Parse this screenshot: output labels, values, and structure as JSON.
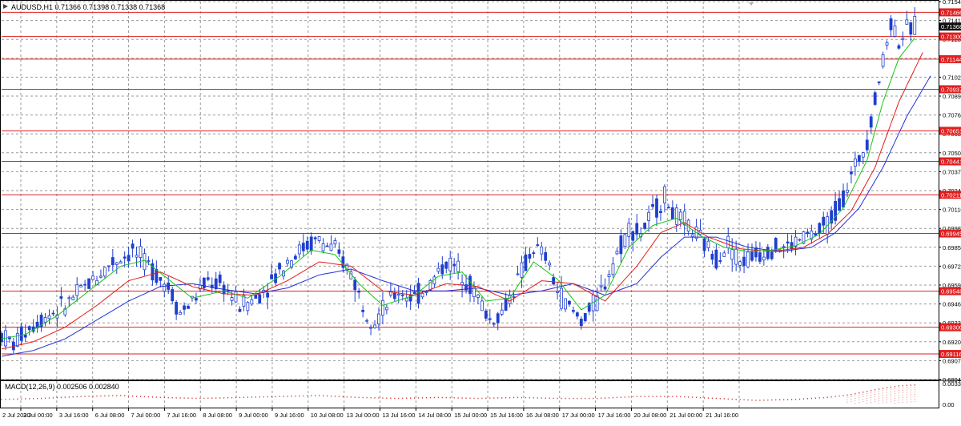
{
  "header": {
    "title": "AUDUSD,H1  0.71366 0.71398 0.71338 0.71368",
    "macd_label": "MACD(12,26,9)  0.002506 0.002840"
  },
  "price_scale": {
    "min": 0.6894,
    "max": 0.7154,
    "ticks": [
      "0.71540",
      "0.71410",
      "0.71280",
      "0.71150",
      "0.71020",
      "0.70890",
      "0.70760",
      "0.70630",
      "0.70500",
      "0.70370",
      "0.70240",
      "0.70110",
      "0.69980",
      "0.69850",
      "0.69720",
      "0.69590",
      "0.69460",
      "0.69330",
      "0.69200",
      "0.69070",
      "0.68940"
    ],
    "tick_values": [
      0.7154,
      0.7141,
      0.7128,
      0.7115,
      0.7102,
      0.7089,
      0.7076,
      0.7063,
      0.705,
      0.7037,
      0.7024,
      0.7011,
      0.6998,
      0.6985,
      0.6972,
      0.6959,
      0.6946,
      0.6933,
      0.692,
      0.6907,
      0.6894
    ],
    "current_price": "0.71368",
    "current_price_value": 0.71368
  },
  "horizontal_levels": [
    {
      "label": "0.71466",
      "value": 0.71466
    },
    {
      "label": "0.71300",
      "value": 0.713
    },
    {
      "label": "0.71144",
      "value": 0.71144
    },
    {
      "label": "0.70937",
      "value": 0.70937
    },
    {
      "label": "0.70651",
      "value": 0.70651
    },
    {
      "label": "0.70441",
      "value": 0.70441
    },
    {
      "label": "0.70211",
      "value": 0.70211
    },
    {
      "label": "0.69945",
      "value": 0.69945
    },
    {
      "label": "0.69548",
      "value": 0.69548
    },
    {
      "label": "0.69300",
      "value": 0.693
    },
    {
      "label": "0.69116",
      "value": 0.69116
    }
  ],
  "macd_scale": {
    "ticks": [
      "0.00335",
      "0.00"
    ]
  },
  "time_axis": [
    "2 Jul 2020",
    "3 Jul 00:00",
    "3 Jul 16:00",
    "6 Jul 08:00",
    "7 Jul 00:00",
    "7 Jul 16:00",
    "8 Jul 08:00",
    "9 Jul 00:00",
    "9 Jul 16:00",
    "10 Jul 08:00",
    "13 Jul 00:00",
    "13 Jul 16:00",
    "14 Jul 08:00",
    "15 Jul 00:00",
    "15 Jul 16:00",
    "16 Jul 08:00",
    "17 Jul 00:00",
    "17 Jul 16:00",
    "20 Jul 08:00",
    "21 Jul 00:00",
    "21 Jul 16:00"
  ],
  "colors": {
    "background": "#ffffff",
    "grid": "#9a9a9a",
    "candles": "#1f3fcf",
    "ma_fast": "#19c319",
    "ma_mid": "#e21d1d",
    "ma_slow": "#2333d6",
    "level_line": "#e02020",
    "level_label_bg": "#e02020",
    "current_label_bg": "#111111",
    "macd": "#d23a3a"
  },
  "chart_data": {
    "type": "candlestick",
    "symbol": "AUDUSD",
    "timeframe": "H1",
    "ylim": [
      0.6894,
      0.7154
    ],
    "price_path": [
      [
        0,
        0.6925
      ],
      [
        3,
        0.6918
      ],
      [
        6,
        0.6928
      ],
      [
        10,
        0.6936
      ],
      [
        16,
        0.6945
      ],
      [
        22,
        0.696
      ],
      [
        28,
        0.6975
      ],
      [
        33,
        0.6982
      ],
      [
        38,
        0.697
      ],
      [
        42,
        0.6958
      ],
      [
        45,
        0.694
      ],
      [
        48,
        0.6948
      ],
      [
        52,
        0.6962
      ],
      [
        56,
        0.6958
      ],
      [
        60,
        0.6945
      ],
      [
        64,
        0.695
      ],
      [
        68,
        0.6962
      ],
      [
        72,
        0.6976
      ],
      [
        76,
        0.6985
      ],
      [
        80,
        0.699
      ],
      [
        84,
        0.6982
      ],
      [
        88,
        0.6968
      ],
      [
        91,
        0.6945
      ],
      [
        94,
        0.6935
      ],
      [
        97,
        0.6945
      ],
      [
        100,
        0.6955
      ],
      [
        104,
        0.695
      ],
      [
        108,
        0.696
      ],
      [
        112,
        0.6975
      ],
      [
        116,
        0.6968
      ],
      [
        120,
        0.695
      ],
      [
        123,
        0.6935
      ],
      [
        126,
        0.694
      ],
      [
        130,
        0.6962
      ],
      [
        134,
        0.6985
      ],
      [
        137,
        0.6978
      ],
      [
        140,
        0.6955
      ],
      [
        143,
        0.6943
      ],
      [
        146,
        0.6935
      ],
      [
        150,
        0.6948
      ],
      [
        154,
        0.6975
      ],
      [
        158,
        0.6998
      ],
      [
        161,
        0.6995
      ],
      [
        164,
        0.7008
      ],
      [
        167,
        0.702
      ],
      [
        170,
        0.7005
      ],
      [
        173,
        0.7
      ],
      [
        176,
        0.699
      ],
      [
        180,
        0.6978
      ],
      [
        183,
        0.6988
      ],
      [
        186,
        0.6975
      ],
      [
        190,
        0.698
      ],
      [
        194,
        0.6985
      ],
      [
        198,
        0.6985
      ],
      [
        202,
        0.6992
      ],
      [
        206,
        0.6995
      ],
      [
        209,
        0.7005
      ],
      [
        212,
        0.702
      ],
      [
        215,
        0.704
      ],
      [
        218,
        0.706
      ],
      [
        221,
        0.71
      ],
      [
        224,
        0.714
      ],
      [
        226,
        0.7128
      ],
      [
        228,
        0.7134
      ],
      [
        230,
        0.7137
      ]
    ],
    "ma_fast_path": [
      [
        0,
        0.6922
      ],
      [
        6,
        0.6925
      ],
      [
        14,
        0.6938
      ],
      [
        22,
        0.6955
      ],
      [
        30,
        0.6972
      ],
      [
        36,
        0.6976
      ],
      [
        42,
        0.6963
      ],
      [
        48,
        0.695
      ],
      [
        56,
        0.6955
      ],
      [
        62,
        0.695
      ],
      [
        70,
        0.6965
      ],
      [
        78,
        0.6983
      ],
      [
        84,
        0.698
      ],
      [
        90,
        0.696
      ],
      [
        96,
        0.6945
      ],
      [
        104,
        0.6952
      ],
      [
        110,
        0.6965
      ],
      [
        116,
        0.6968
      ],
      [
        122,
        0.6948
      ],
      [
        128,
        0.695
      ],
      [
        134,
        0.6975
      ],
      [
        140,
        0.6963
      ],
      [
        146,
        0.6942
      ],
      [
        152,
        0.6952
      ],
      [
        158,
        0.6985
      ],
      [
        164,
        0.7
      ],
      [
        170,
        0.7005
      ],
      [
        176,
        0.6993
      ],
      [
        182,
        0.6985
      ],
      [
        188,
        0.6982
      ],
      [
        194,
        0.6983
      ],
      [
        200,
        0.6986
      ],
      [
        206,
        0.6994
      ],
      [
        212,
        0.7012
      ],
      [
        218,
        0.7045
      ],
      [
        222,
        0.7085
      ],
      [
        226,
        0.7115
      ],
      [
        230,
        0.7129
      ]
    ],
    "ma_mid_path": [
      [
        0,
        0.6915
      ],
      [
        8,
        0.692
      ],
      [
        16,
        0.693
      ],
      [
        24,
        0.6945
      ],
      [
        32,
        0.6962
      ],
      [
        40,
        0.6968
      ],
      [
        48,
        0.6958
      ],
      [
        56,
        0.6953
      ],
      [
        64,
        0.6952
      ],
      [
        72,
        0.6962
      ],
      [
        80,
        0.6975
      ],
      [
        88,
        0.6972
      ],
      [
        96,
        0.6955
      ],
      [
        104,
        0.6952
      ],
      [
        112,
        0.696
      ],
      [
        120,
        0.6958
      ],
      [
        128,
        0.6948
      ],
      [
        136,
        0.6962
      ],
      [
        144,
        0.696
      ],
      [
        152,
        0.6948
      ],
      [
        160,
        0.6972
      ],
      [
        166,
        0.6995
      ],
      [
        172,
        0.7002
      ],
      [
        178,
        0.6992
      ],
      [
        186,
        0.6984
      ],
      [
        194,
        0.6982
      ],
      [
        202,
        0.6985
      ],
      [
        208,
        0.6994
      ],
      [
        214,
        0.701
      ],
      [
        220,
        0.704
      ],
      [
        226,
        0.7085
      ],
      [
        232,
        0.7119
      ]
    ],
    "ma_slow_path": [
      [
        0,
        0.691
      ],
      [
        8,
        0.6914
      ],
      [
        16,
        0.6922
      ],
      [
        24,
        0.6935
      ],
      [
        32,
        0.6948
      ],
      [
        40,
        0.6958
      ],
      [
        48,
        0.696
      ],
      [
        56,
        0.6956
      ],
      [
        64,
        0.6953
      ],
      [
        72,
        0.6957
      ],
      [
        80,
        0.6966
      ],
      [
        88,
        0.697
      ],
      [
        96,
        0.6962
      ],
      [
        104,
        0.6955
      ],
      [
        112,
        0.6955
      ],
      [
        120,
        0.6957
      ],
      [
        128,
        0.6952
      ],
      [
        136,
        0.6955
      ],
      [
        144,
        0.696
      ],
      [
        152,
        0.6952
      ],
      [
        160,
        0.696
      ],
      [
        166,
        0.6978
      ],
      [
        172,
        0.6992
      ],
      [
        180,
        0.6992
      ],
      [
        188,
        0.6985
      ],
      [
        196,
        0.6982
      ],
      [
        204,
        0.6985
      ],
      [
        210,
        0.6995
      ],
      [
        216,
        0.7012
      ],
      [
        222,
        0.704
      ],
      [
        228,
        0.7075
      ],
      [
        234,
        0.7103
      ]
    ],
    "macd_hist_path": [
      [
        0,
        0.25
      ],
      [
        10,
        0.3
      ],
      [
        20,
        0.4
      ],
      [
        30,
        0.45
      ],
      [
        40,
        0.35
      ],
      [
        50,
        0.3
      ],
      [
        60,
        0.35
      ],
      [
        70,
        0.4
      ],
      [
        80,
        0.45
      ],
      [
        90,
        0.35
      ],
      [
        100,
        0.3
      ],
      [
        110,
        0.35
      ],
      [
        120,
        0.3
      ],
      [
        130,
        0.35
      ],
      [
        140,
        0.3
      ],
      [
        150,
        0.3
      ],
      [
        160,
        0.4
      ],
      [
        170,
        0.4
      ],
      [
        180,
        0.3
      ],
      [
        190,
        0.2
      ],
      [
        200,
        0.25
      ],
      [
        208,
        0.35
      ],
      [
        214,
        0.5
      ],
      [
        220,
        0.75
      ],
      [
        226,
        0.95
      ],
      [
        230,
        1.0
      ]
    ]
  }
}
